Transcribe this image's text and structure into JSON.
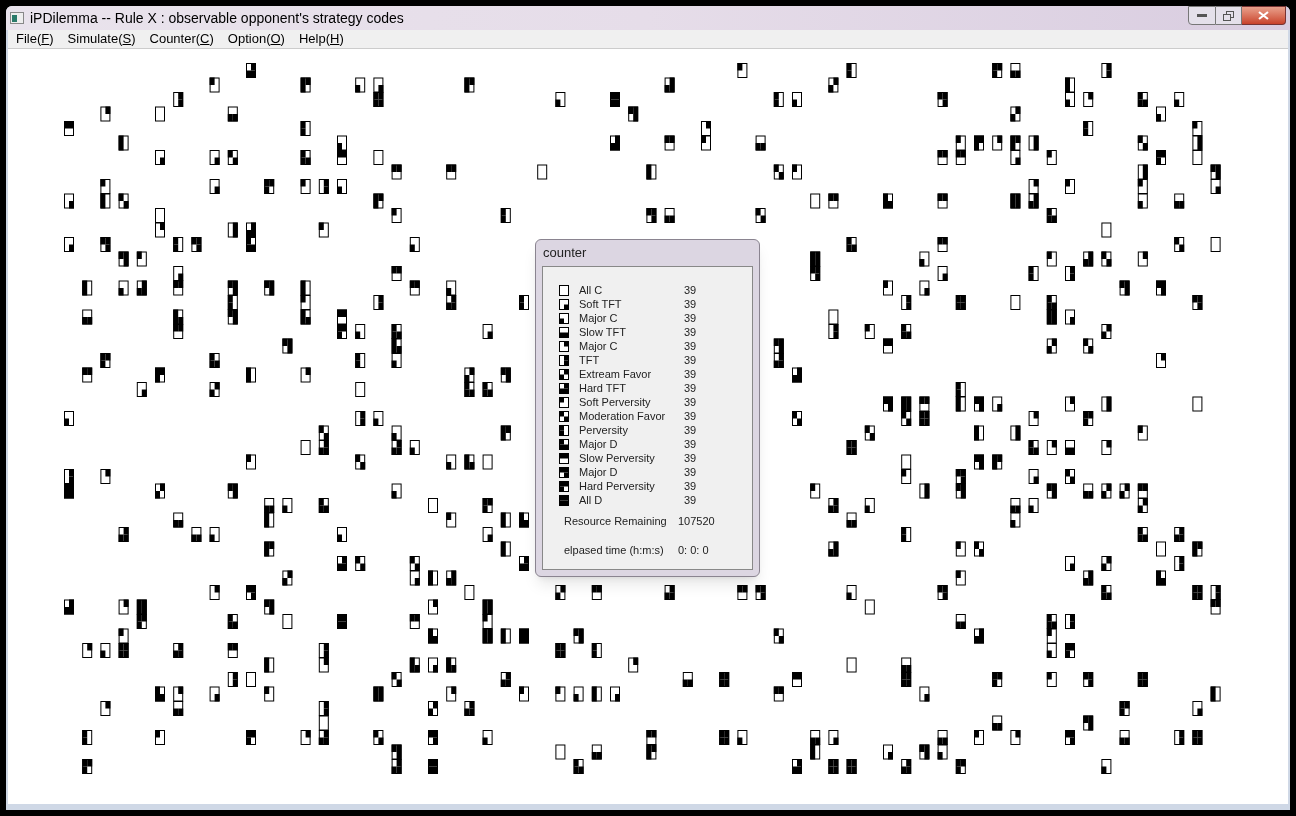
{
  "window": {
    "title": "iPDilemma -- Rule X : observable opponent's strategy codes"
  },
  "menu": [
    {
      "label": "File(",
      "key": "F",
      "end": ")"
    },
    {
      "label": "Simulate(",
      "key": "S",
      "end": ")"
    },
    {
      "label": "Counter(",
      "key": "C",
      "end": ")"
    },
    {
      "label": "Option(",
      "key": "O",
      "end": ")"
    },
    {
      "label": "Help(",
      "key": "H",
      "end": ")"
    }
  ],
  "counter": {
    "title": "counter",
    "strategies": [
      {
        "name": "All C",
        "count": "39"
      },
      {
        "name": "Soft TFT",
        "count": "39"
      },
      {
        "name": "Major C",
        "count": "39"
      },
      {
        "name": "Slow TFT",
        "count": "39"
      },
      {
        "name": "Major C",
        "count": "39"
      },
      {
        "name": "TFT",
        "count": "39"
      },
      {
        "name": "Extream Favor",
        "count": "39"
      },
      {
        "name": "Hard TFT",
        "count": "39"
      },
      {
        "name": "Soft Perversity",
        "count": "39"
      },
      {
        "name": "Moderation Favor",
        "count": "39"
      },
      {
        "name": "Perversity",
        "count": "39"
      },
      {
        "name": "Major D",
        "count": "39"
      },
      {
        "name": "Slow Perversity",
        "count": "39"
      },
      {
        "name": "Major D",
        "count": "39"
      },
      {
        "name": "Hard Perversity",
        "count": "39"
      },
      {
        "name": "All D",
        "count": "39"
      }
    ],
    "resource": {
      "label": "Resource Remaining",
      "value": "107520"
    },
    "elapsed": {
      "label": "elpased time (h:m:s)",
      "value": "0: 0: 0"
    }
  }
}
